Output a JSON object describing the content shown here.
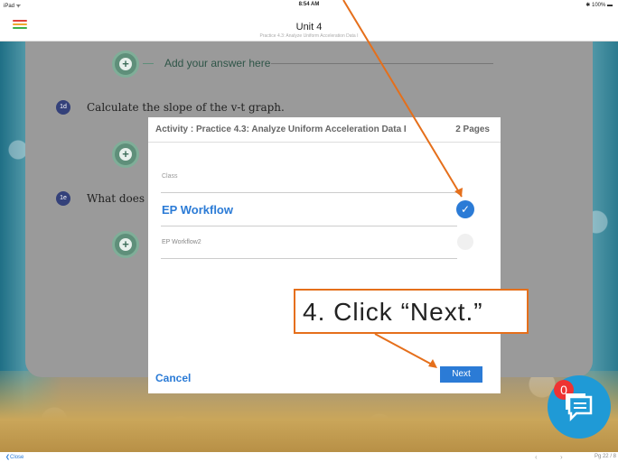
{
  "status_bar": {
    "carrier": "iPad ᯤ",
    "time": "8:54 AM",
    "battery": "✱ 100% ▬"
  },
  "nav": {
    "title": "Unit 4",
    "subtitle": "Practice 4.3: Analyze Uniform Acceleration Data I",
    "menu_icon_colors": [
      "#e0433a",
      "#f0a830",
      "#3bb04a",
      "#2b7bd6"
    ]
  },
  "content": {
    "answer_placeholder": "Add your answer here",
    "add_icon": "+",
    "questions": [
      {
        "badge": "1d",
        "text": "Calculate the slope of the v-t graph."
      },
      {
        "badge": "1e",
        "text": "What does"
      }
    ]
  },
  "dialog": {
    "title": "Activity : Practice 4.3: Analyze Uniform Acceleration Data I",
    "pages": "2 Pages",
    "section_label": "Class",
    "options": [
      {
        "label": "EP Workflow",
        "selected": true
      },
      {
        "label": "EP Workflow2",
        "selected": false
      }
    ],
    "check_icon": "✓",
    "cancel_label": "Cancel",
    "next_label": "Next"
  },
  "callout": {
    "text": "4. Click “Next.”",
    "color": "#e56f1b"
  },
  "chat": {
    "badge_count": "0"
  },
  "bottom_bar": {
    "close_label": "❮Close",
    "prev_icon": "‹",
    "next_icon": "›",
    "page_label": "Pg 22 / 8"
  }
}
